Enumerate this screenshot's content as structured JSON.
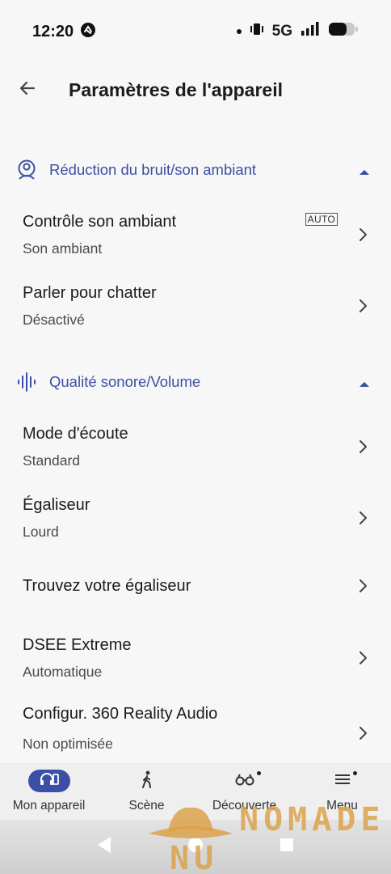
{
  "status_bar": {
    "time": "12:20",
    "network": "5G"
  },
  "header": {
    "title": "Paramètres de l'appareil"
  },
  "sections": [
    {
      "label": "Réduction du bruit/son ambiant",
      "rows": [
        {
          "title": "Contrôle son ambiant",
          "subtitle": "Son ambiant",
          "badge": "AUTO"
        },
        {
          "title": "Parler pour chatter",
          "subtitle": "Désactivé"
        }
      ]
    },
    {
      "label": "Qualité sonore/Volume",
      "rows": [
        {
          "title": "Mode d'écoute",
          "subtitle": "Standard"
        },
        {
          "title": "Égaliseur",
          "subtitle": "Lourd"
        },
        {
          "title": "Trouvez votre égaliseur"
        },
        {
          "title": "DSEE Extreme",
          "subtitle": "Automatique"
        },
        {
          "title": "Configur. 360 Reality Audio",
          "subtitle": "Non optimisée"
        }
      ]
    }
  ],
  "bottom_nav": [
    {
      "label": "Mon appareil",
      "icon": "headphones-device-icon",
      "active": true
    },
    {
      "label": "Scène",
      "icon": "walking-person-icon"
    },
    {
      "label": "Découverte",
      "icon": "binoculars-icon",
      "notification": true
    },
    {
      "label": "Menu",
      "icon": "menu-icon",
      "notification": true
    }
  ],
  "watermark": {
    "line1": "NOMADE",
    "line2": "NU URBAIN"
  },
  "colors": {
    "accent": "#3b4fa6",
    "background": "#f7f7f7",
    "watermark": "#daa046"
  }
}
